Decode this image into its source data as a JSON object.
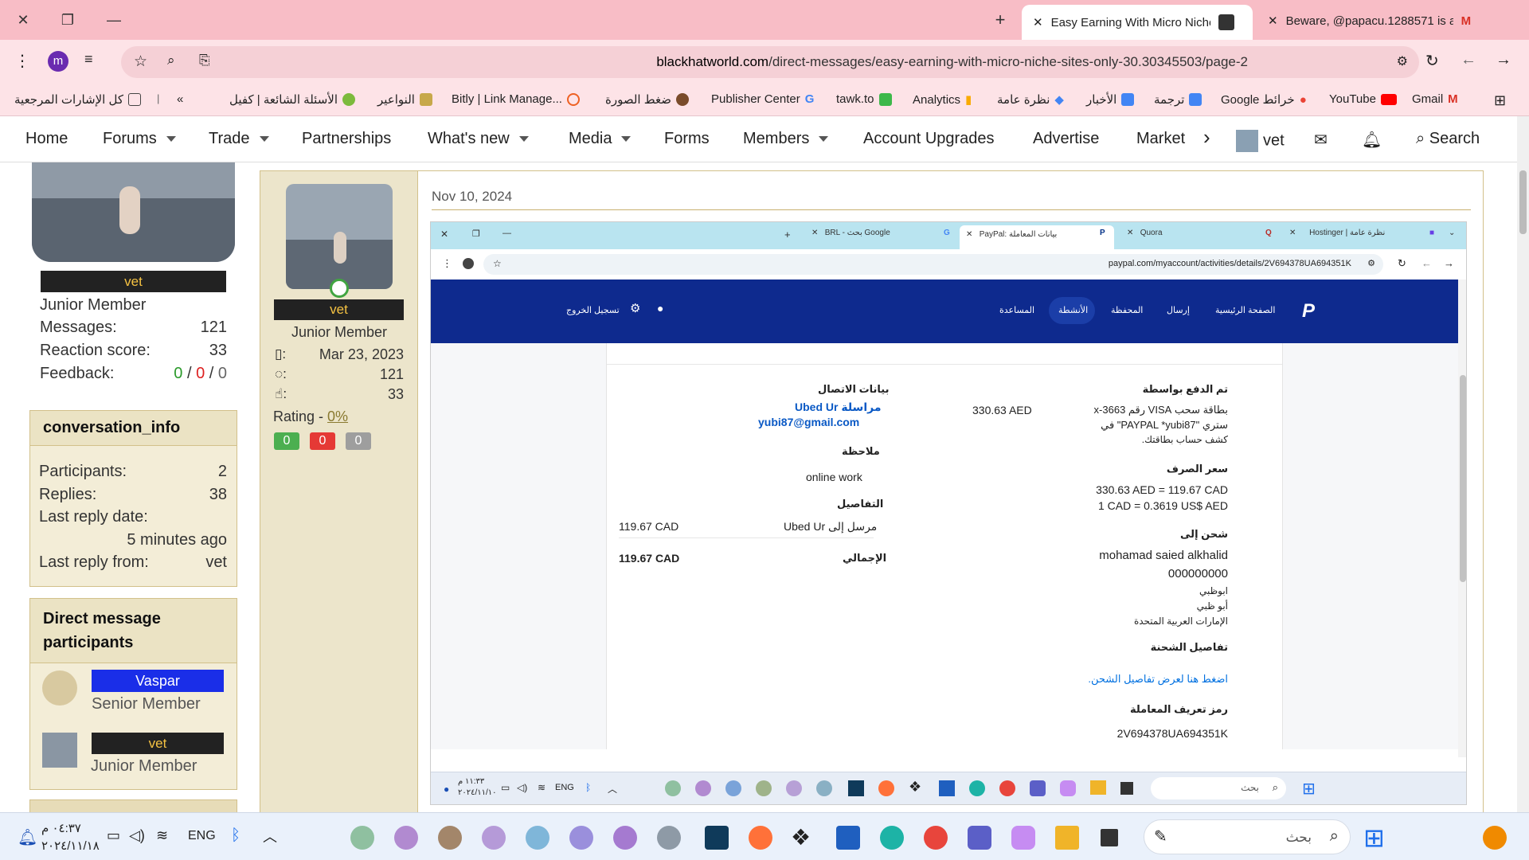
{
  "browser": {
    "tabs": [
      {
        "title": "Easy Earning With Micro Niche",
        "active": true
      },
      {
        "title": "Beware, @papacu.1288571 is a",
        "active": false
      }
    ],
    "url_host": "blackhatworld.com",
    "url_path": "/direct-messages/easy-earning-with-micro-niche-sites-only-30.30345503/page-2",
    "profile_letter": "m"
  },
  "bookmarks": [
    {
      "label": "كل الإشارات المرجعية"
    },
    {
      "label": "الأسئلة الشائعة | كفيل"
    },
    {
      "label": "النواعير"
    },
    {
      "label": "Bitly | Link Manage..."
    },
    {
      "label": "ضغط الصورة"
    },
    {
      "label": "Publisher Center"
    },
    {
      "label": "tawk.to"
    },
    {
      "label": "Analytics"
    },
    {
      "label": "نظرة عامة"
    },
    {
      "label": "الأخبار"
    },
    {
      "label": "ترجمة"
    },
    {
      "label": "Google خرائط"
    },
    {
      "label": "YouTube"
    },
    {
      "label": "Gmail"
    }
  ],
  "nav": {
    "items": [
      "Home",
      "Forums",
      "Trade",
      "Partnerships",
      "What's new",
      "Media",
      "Forms",
      "Members",
      "Account Upgrades",
      "Advertise",
      "Market"
    ],
    "user": "vet",
    "search": "Search"
  },
  "sidebar": {
    "profile": {
      "badge": "vet",
      "title": "Junior Member",
      "messages_label": "Messages:",
      "messages": "121",
      "reaction_label": "Reaction score:",
      "reaction": "33",
      "feedback_label": "Feedback:",
      "fb_pos": "0",
      "fb_neu": "0",
      "fb_neg": "0"
    },
    "conversation_info": {
      "title": "conversation_info",
      "participants_label": "Participants:",
      "participants": "2",
      "replies_label": "Replies:",
      "replies": "38",
      "last_date_label": "Last reply date:",
      "last_date": "5 minutes ago",
      "last_from_label": "Last reply from:",
      "last_from": "vet"
    },
    "participants": {
      "title": "Direct message participants",
      "users": [
        {
          "name": "Vaspar",
          "title": "Senior Member"
        },
        {
          "name": "vet",
          "title": "Junior Member"
        }
      ]
    }
  },
  "post": {
    "author": {
      "badge": "vet",
      "title": "Junior Member",
      "joined": "Mar 23, 2023",
      "messages": "121",
      "reactions": "33",
      "rating_label": "Rating - ",
      "rating": "0%",
      "pos": "0",
      "neg": "0",
      "neu": "0"
    },
    "date": "Nov 10, 2024"
  },
  "screenshot": {
    "tabs": [
      "BRL - بحث Google",
      "PayPal: بيانات المعاملة",
      "Quora",
      "Hostinger | نظرة عامة"
    ],
    "url": "paypal.com/myaccount/activities/details/2V694378UA694351K",
    "nav": [
      "الصفحة الرئيسية",
      "إرسال",
      "المحفظة",
      "الأنشطة",
      "المساعدة"
    ],
    "logout": "تسجيل الخروج",
    "paid_with_label": "تم الدفع بواسطة",
    "card_line1": "بطاقة سحب VISA رقم x-3663",
    "card_line2": "ستري \"PAYPAL *yubi87\" في",
    "card_line3": "كشف حساب بطاقتك.",
    "amount_aed": "330.63 AED",
    "contact_label": "بيانات الاتصال",
    "contact_name": "مراسلة Ubed Ur",
    "contact_email": "yubi87@gmail.com",
    "note_label": "ملاحظة",
    "note": "online work",
    "details_label": "التفاصيل",
    "sent_to": "مرسل إلى Ubed Ur",
    "sent_amount": "119.67 CAD",
    "total_label": "الإجمالي",
    "total": "119.67 CAD",
    "fx_label": "سعر الصرف",
    "fx1": "330.63 AED = 119.67 CAD",
    "fx2": "1 CAD = 0.3619 US$ AED",
    "ship_label": "شحن إلى",
    "ship_name": "mohamad saied alkhalid",
    "ship_zip": "000000000",
    "ship_city1": "ابوظبي",
    "ship_city2": "أبو ظبي",
    "ship_country": "الإمارات العربية المتحدة",
    "ship_details_label": "تفاصيل الشحنة",
    "ship_details_link": "اضغط هنا لعرض تفاصيل الشحن.",
    "txn_label": "رمز تعريف المعاملة",
    "txn_id": "2V694378UA694351K",
    "taskbar_time": "١١:٣٣ م",
    "taskbar_date": "٢٠٢٤/١١/١٠",
    "taskbar_lang": "ENG",
    "taskbar_search": "بحث"
  },
  "taskbar": {
    "time": "٠٤:٣٧ م",
    "date": "٢٠٢٤/١١/١٨",
    "lang": "ENG",
    "search": "بحث"
  }
}
